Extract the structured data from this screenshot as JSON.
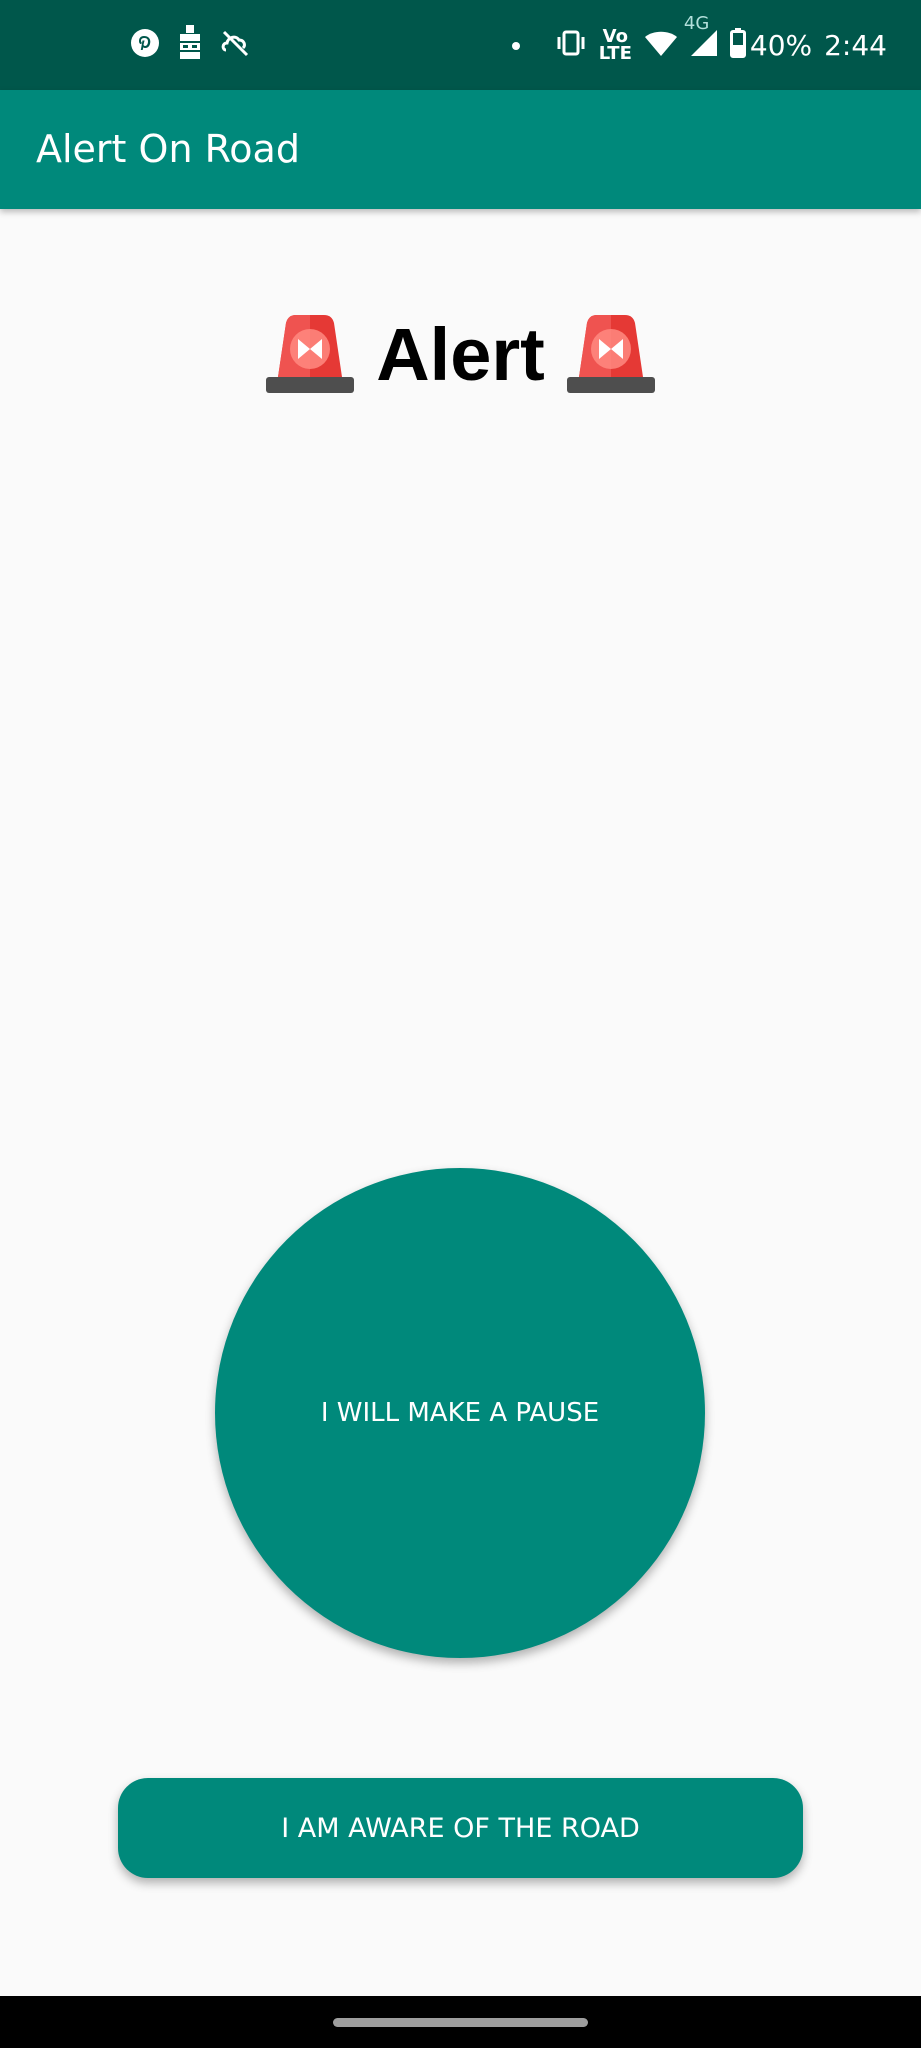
{
  "status_bar": {
    "battery_percent": "40%",
    "time": "2:44",
    "network_type": "4G",
    "volte_top": "Vo",
    "volte_bottom": "LTE",
    "icons": [
      "pinterest-icon",
      "notification-app-icon",
      "sync-off-icon",
      "dot-icon",
      "vibrate-icon",
      "volte-icon",
      "wifi-icon",
      "signal-icon",
      "battery-icon"
    ]
  },
  "app_bar": {
    "title": "Alert On Road"
  },
  "main": {
    "heading": "Alert",
    "heading_icon": "police-siren-icon",
    "pause_button_label": "I WILL MAKE A PAUSE",
    "aware_button_label": "I AM AWARE OF THE ROAD"
  },
  "colors": {
    "status_bar": "#00574b",
    "primary": "#00897b",
    "background": "#fafafa",
    "siren_red": "#e53935"
  }
}
